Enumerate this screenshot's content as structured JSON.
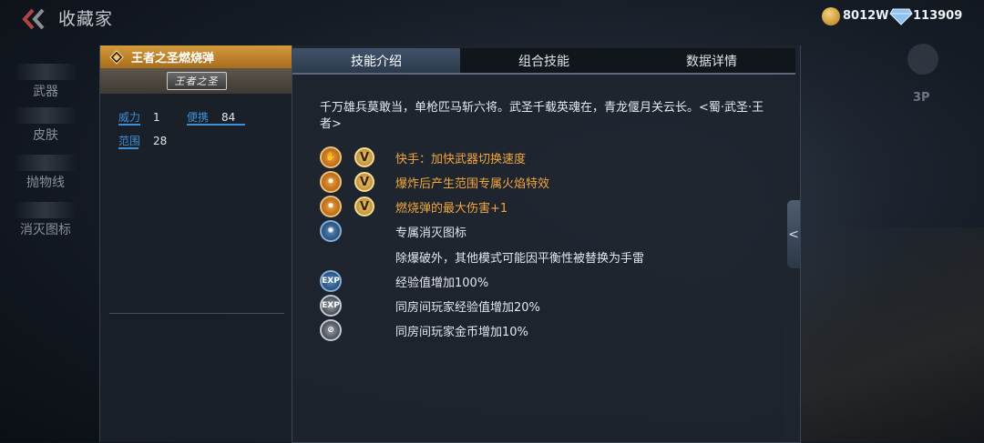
{
  "header": {
    "title": "收藏家",
    "gold": "8012W",
    "diamonds": "113909"
  },
  "sidebar": {
    "items": [
      {
        "label": "武器"
      },
      {
        "label": "皮肤"
      },
      {
        "label": "抛物线"
      },
      {
        "label": "消灭图标"
      }
    ]
  },
  "item": {
    "name": "王者之圣燃烧弹",
    "badge": "王者之圣",
    "stats": {
      "power_label": "威力",
      "power_value": "1",
      "portable_label": "便携",
      "portable_value": "84",
      "range_label": "范围",
      "range_value": "28"
    }
  },
  "tabs": [
    {
      "label": "技能介绍",
      "active": true
    },
    {
      "label": "组合技能",
      "active": false
    },
    {
      "label": "数据详情",
      "active": false
    }
  ],
  "description": "千万雄兵莫敢当，单枪匹马斩六将。武圣千载英魂在，青龙偃月关云长。<蜀·武圣·王者>",
  "skills": [
    {
      "icon": "fast-hand-icon",
      "text": "快手：加快武器切换速度",
      "color": "orange",
      "v_badge": true
    },
    {
      "icon": "flame-explosion-icon",
      "text": "爆炸后产生范围专属火焰特效",
      "color": "orange",
      "v_badge": true
    },
    {
      "icon": "burn-damage-icon",
      "text": "燃烧弹的最大伤害+1",
      "color": "orange",
      "v_badge": true
    },
    {
      "icon": "kill-icon-icon",
      "text": "专属消灭图标",
      "color": "white",
      "v_badge": false
    },
    {
      "icon": "",
      "text": "除爆破外，其他模式可能因平衡性被替换为手雷",
      "color": "white",
      "v_badge": false
    },
    {
      "icon": "exp-boost-icon",
      "text": "经验值增加100%",
      "color": "white",
      "v_badge": false
    },
    {
      "icon": "room-exp-icon",
      "text": "同房间玩家经验值增加20%",
      "color": "white",
      "v_badge": false
    },
    {
      "icon": "room-gold-icon",
      "text": "同房间玩家金币增加10%",
      "color": "white",
      "v_badge": false
    }
  ],
  "side_controls": {
    "view_label": "3P",
    "expand_glyph": "<"
  }
}
